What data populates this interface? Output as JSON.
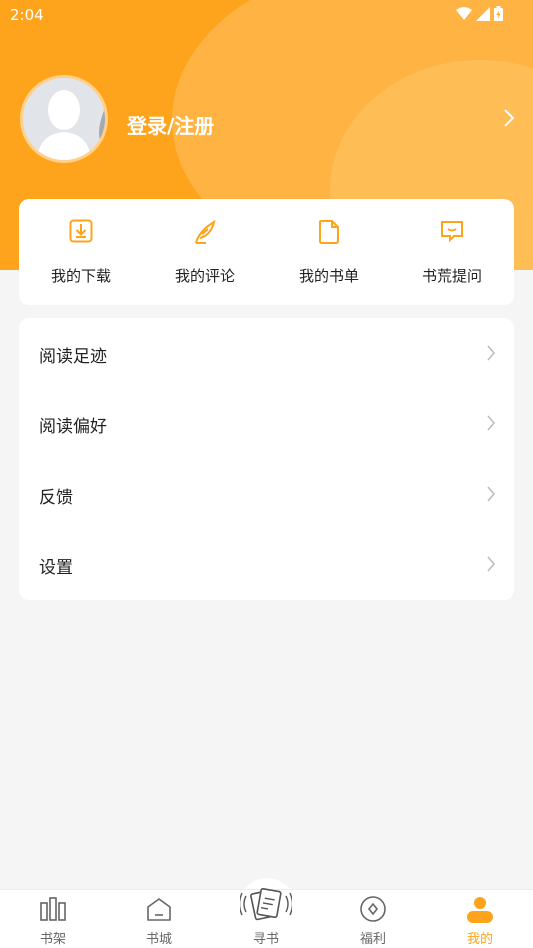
{
  "status": {
    "time": "2:04"
  },
  "profile": {
    "login_label": "登录/注册"
  },
  "quick_actions": [
    {
      "label": "我的下载",
      "icon": "download-icon"
    },
    {
      "label": "我的评论",
      "icon": "quill-icon"
    },
    {
      "label": "我的书单",
      "icon": "document-icon"
    },
    {
      "label": "书荒提问",
      "icon": "chat-icon"
    }
  ],
  "menu": [
    {
      "label": "阅读足迹"
    },
    {
      "label": "阅读偏好"
    },
    {
      "label": "反馈"
    },
    {
      "label": "设置"
    }
  ],
  "tabs": [
    {
      "label": "书架",
      "icon": "bookshelf-icon"
    },
    {
      "label": "书城",
      "icon": "home-icon"
    },
    {
      "label": "寻书",
      "icon": "book-shake-icon"
    },
    {
      "label": "福利",
      "icon": "coin-icon"
    },
    {
      "label": "我的",
      "icon": "profile-icon",
      "active": true
    }
  ],
  "colors": {
    "accent": "#fea41c",
    "background": "#f5f5f5"
  }
}
